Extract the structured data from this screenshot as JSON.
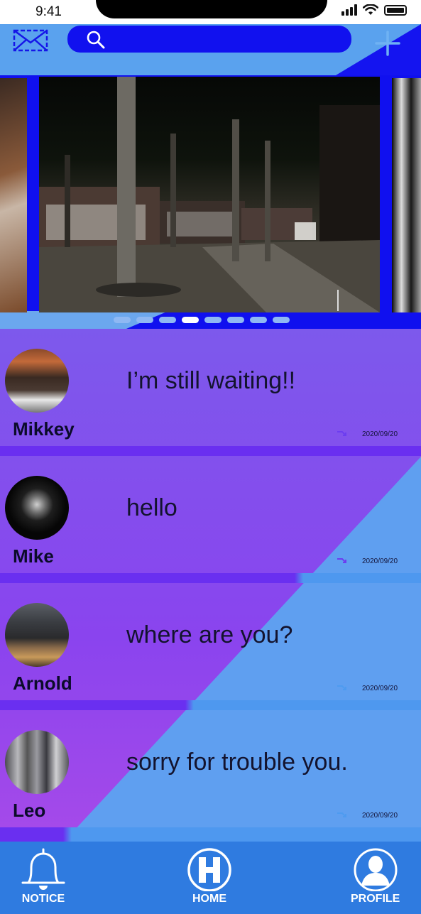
{
  "status_bar": {
    "time": "9:41"
  },
  "header": {
    "mail_icon": "mail-envelope-icon",
    "search_icon": "search-icon",
    "search_placeholder": "",
    "add_icon": "plus-icon"
  },
  "carousel": {
    "dots_count": 8,
    "active_index": 3
  },
  "messages": [
    {
      "name": "Mikkey",
      "text": "I’m still waiting!!",
      "date": "2020/09/20"
    },
    {
      "name": "Mike",
      "text": "hello",
      "date": "2020/09/20"
    },
    {
      "name": "Arnold",
      "text": "where are you?",
      "date": "2020/09/20"
    },
    {
      "name": "Leo",
      "text": "sorry for trouble you.",
      "date": "2020/09/20"
    }
  ],
  "nav": {
    "notice": "NOTICE",
    "home": "HOME",
    "profile": "PROFILE"
  },
  "colors": {
    "accent_blue": "#1111ef",
    "light_blue": "#5f9ff0",
    "purple": "#8a44ee",
    "nav_blue": "#2f7be0"
  }
}
